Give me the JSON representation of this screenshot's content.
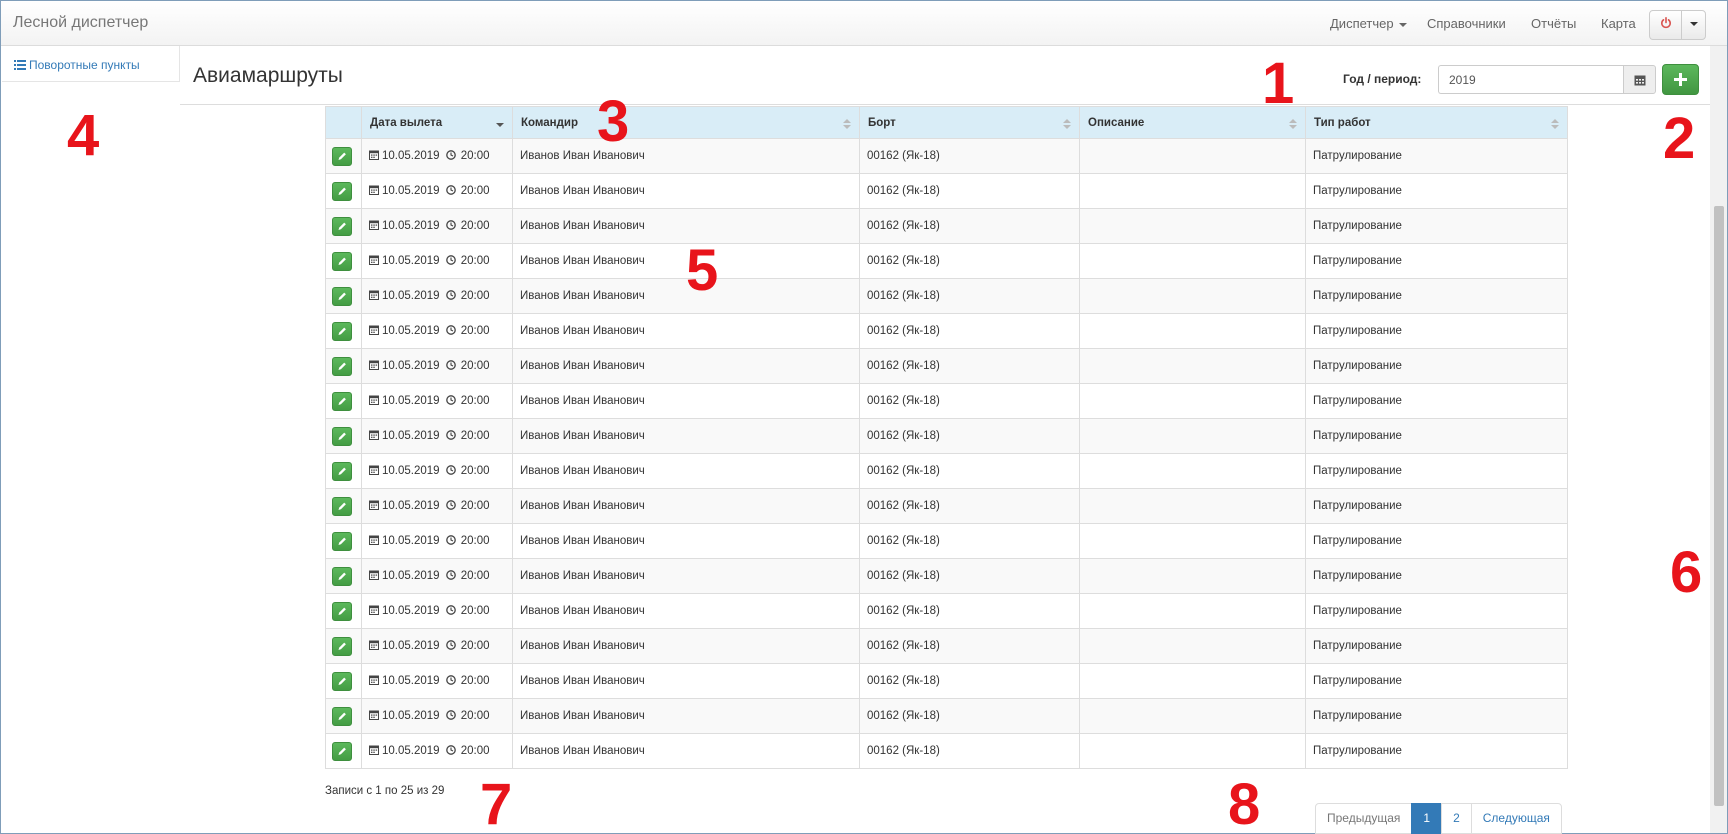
{
  "navbar": {
    "brand": "Лесной диспетчер",
    "links": [
      {
        "label": "Диспетчер"
      },
      {
        "label": "Справочники"
      },
      {
        "label": "Отчёты"
      },
      {
        "label": "Карта"
      }
    ],
    "power_icon": "power-icon",
    "accent_color": "#d9534f"
  },
  "sidebar": {
    "items": [
      {
        "label": "Поворотные пункты",
        "icon": "list-icon"
      }
    ]
  },
  "page": {
    "title": "Авиамаршруты",
    "period_label": "Год / период:",
    "period_value": "2019",
    "calendar_icon": "calendar-icon",
    "add_icon": "plus-icon"
  },
  "table": {
    "columns": [
      "",
      "Дата вылета",
      "Командир",
      "Борт",
      "Описание",
      "Тип работ"
    ],
    "sort_column": "Дата вылета",
    "rows": [
      {
        "date": "10.05.2019",
        "time": "20:00",
        "commander": "Иванов Иван Иванович",
        "board": "00162 (Як-18)",
        "description": "",
        "work_type": "Патрулирование"
      },
      {
        "date": "10.05.2019",
        "time": "20:00",
        "commander": "Иванов Иван Иванович",
        "board": "00162 (Як-18)",
        "description": "",
        "work_type": "Патрулирование"
      },
      {
        "date": "10.05.2019",
        "time": "20:00",
        "commander": "Иванов Иван Иванович",
        "board": "00162 (Як-18)",
        "description": "",
        "work_type": "Патрулирование"
      },
      {
        "date": "10.05.2019",
        "time": "20:00",
        "commander": "Иванов Иван Иванович",
        "board": "00162 (Як-18)",
        "description": "",
        "work_type": "Патрулирование"
      },
      {
        "date": "10.05.2019",
        "time": "20:00",
        "commander": "Иванов Иван Иванович",
        "board": "00162 (Як-18)",
        "description": "",
        "work_type": "Патрулирование"
      },
      {
        "date": "10.05.2019",
        "time": "20:00",
        "commander": "Иванов Иван Иванович",
        "board": "00162 (Як-18)",
        "description": "",
        "work_type": "Патрулирование"
      },
      {
        "date": "10.05.2019",
        "time": "20:00",
        "commander": "Иванов Иван Иванович",
        "board": "00162 (Як-18)",
        "description": "",
        "work_type": "Патрулирование"
      },
      {
        "date": "10.05.2019",
        "time": "20:00",
        "commander": "Иванов Иван Иванович",
        "board": "00162 (Як-18)",
        "description": "",
        "work_type": "Патрулирование"
      },
      {
        "date": "10.05.2019",
        "time": "20:00",
        "commander": "Иванов Иван Иванович",
        "board": "00162 (Як-18)",
        "description": "",
        "work_type": "Патрулирование"
      },
      {
        "date": "10.05.2019",
        "time": "20:00",
        "commander": "Иванов Иван Иванович",
        "board": "00162 (Як-18)",
        "description": "",
        "work_type": "Патрулирование"
      },
      {
        "date": "10.05.2019",
        "time": "20:00",
        "commander": "Иванов Иван Иванович",
        "board": "00162 (Як-18)",
        "description": "",
        "work_type": "Патрулирование"
      },
      {
        "date": "10.05.2019",
        "time": "20:00",
        "commander": "Иванов Иван Иванович",
        "board": "00162 (Як-18)",
        "description": "",
        "work_type": "Патрулирование"
      },
      {
        "date": "10.05.2019",
        "time": "20:00",
        "commander": "Иванов Иван Иванович",
        "board": "00162 (Як-18)",
        "description": "",
        "work_type": "Патрулирование"
      },
      {
        "date": "10.05.2019",
        "time": "20:00",
        "commander": "Иванов Иван Иванович",
        "board": "00162 (Як-18)",
        "description": "",
        "work_type": "Патрулирование"
      },
      {
        "date": "10.05.2019",
        "time": "20:00",
        "commander": "Иванов Иван Иванович",
        "board": "00162 (Як-18)",
        "description": "",
        "work_type": "Патрулирование"
      },
      {
        "date": "10.05.2019",
        "time": "20:00",
        "commander": "Иванов Иван Иванович",
        "board": "00162 (Як-18)",
        "description": "",
        "work_type": "Патрулирование"
      },
      {
        "date": "10.05.2019",
        "time": "20:00",
        "commander": "Иванов Иван Иванович",
        "board": "00162 (Як-18)",
        "description": "",
        "work_type": "Патрулирование"
      },
      {
        "date": "10.05.2019",
        "time": "20:00",
        "commander": "Иванов Иван Иванович",
        "board": "00162 (Як-18)",
        "description": "",
        "work_type": "Патрулирование"
      }
    ],
    "edit_icon": "pencil-icon",
    "header_color": "#d9edf7"
  },
  "footer": {
    "info": "Записи с 1 по 25 из 29",
    "pagination": {
      "prev": "Предыдущая",
      "pages": [
        "1",
        "2"
      ],
      "active_page": "1",
      "next": "Следующая"
    }
  },
  "annotations": [
    "1",
    "2",
    "3",
    "4",
    "5",
    "6",
    "7",
    "8"
  ]
}
